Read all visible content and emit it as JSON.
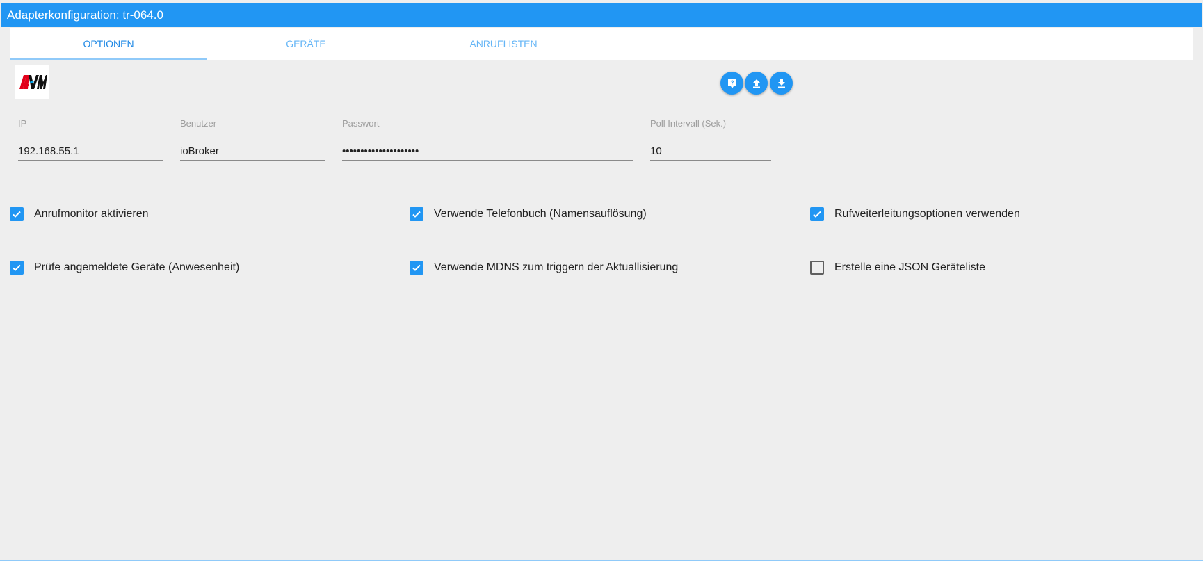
{
  "window": {
    "title": "Adapterkonfiguration: tr-064.0"
  },
  "tabs": [
    {
      "label": "OPTIONEN",
      "active": true
    },
    {
      "label": "GERÄTE",
      "active": false
    },
    {
      "label": "ANRUFLISTEN",
      "active": false
    }
  ],
  "logo": {
    "icon": "avm-logo",
    "text": "AVM"
  },
  "toolbar": {
    "buttons": [
      {
        "icon": "help-icon"
      },
      {
        "icon": "upload-icon"
      },
      {
        "icon": "download-icon"
      }
    ]
  },
  "fields": {
    "ip": {
      "label": "IP",
      "value": "192.168.55.1"
    },
    "user": {
      "label": "Benutzer",
      "value": "ioBroker"
    },
    "password": {
      "label": "Passwort",
      "value": "•••••••••••••••••••••"
    },
    "poll": {
      "label": "Poll Intervall (Sek.)",
      "value": "10"
    }
  },
  "checkboxes": [
    {
      "label": "Anrufmonitor aktivieren",
      "checked": true
    },
    {
      "label": "Verwende Telefonbuch (Namensauflösung)",
      "checked": true
    },
    {
      "label": "Rufweiterleitungsoptionen verwenden",
      "checked": true
    },
    {
      "label": "Prüfe angemeldete Geräte (Anwesenheit)",
      "checked": true
    },
    {
      "label": "Verwende MDNS zum triggern der Aktuallisierung",
      "checked": true
    },
    {
      "label": "Erstelle eine JSON Geräteliste",
      "checked": false
    }
  ],
  "colors": {
    "primary": "#2196f3",
    "tab_active": "#1e88e5",
    "tab_inactive": "#64b5f6",
    "background": "#eeeeee"
  }
}
